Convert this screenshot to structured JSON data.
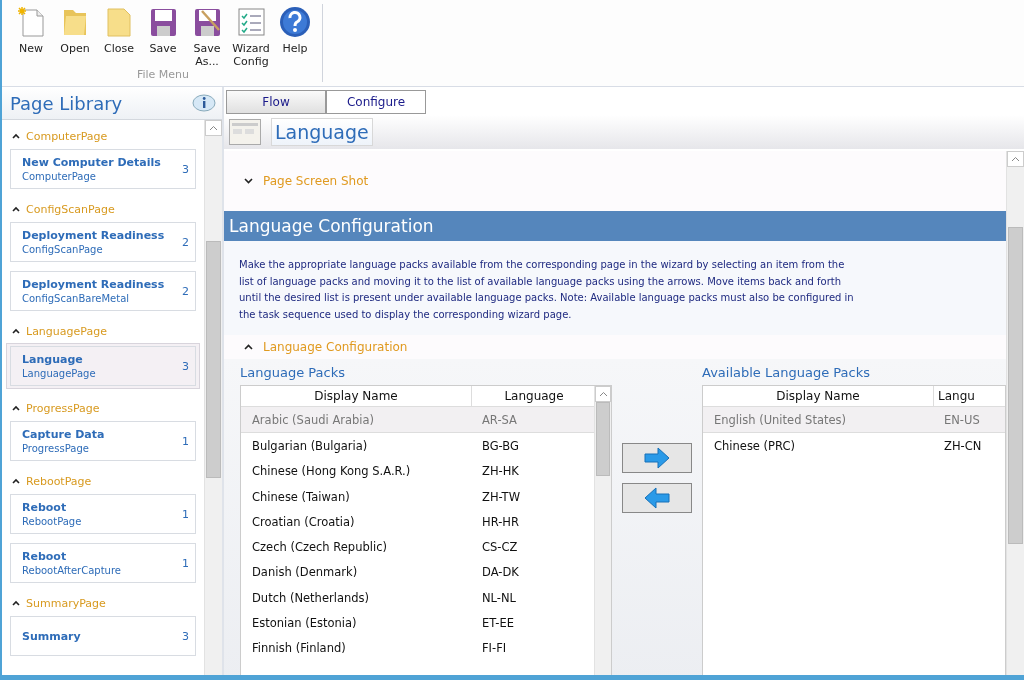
{
  "toolbar": {
    "group_label": "File Menu",
    "buttons": [
      {
        "label": "New",
        "kind": "new"
      },
      {
        "label": "Open",
        "kind": "open"
      },
      {
        "label": "Close",
        "kind": "close"
      },
      {
        "label": "Save",
        "kind": "save"
      },
      {
        "label": "Save As...",
        "kind": "saveas"
      },
      {
        "label": "Wizard Config",
        "kind": "wizard"
      },
      {
        "label": "Help",
        "kind": "help"
      }
    ]
  },
  "sidebar": {
    "title": "Page Library",
    "groups": [
      {
        "name": "ComputerPage",
        "expanded": true,
        "items": [
          {
            "title": "New Computer Details",
            "subtitle": "ComputerPage",
            "count": "3",
            "selected": false
          }
        ]
      },
      {
        "name": "ConfigScanPage",
        "expanded": true,
        "items": [
          {
            "title": "Deployment Readiness",
            "subtitle": "ConfigScanPage",
            "count": "2",
            "selected": false
          },
          {
            "title": "Deployment Readiness",
            "subtitle": "ConfigScanBareMetal",
            "count": "2",
            "selected": false
          }
        ]
      },
      {
        "name": "LanguagePage",
        "expanded": true,
        "items": [
          {
            "title": "Language",
            "subtitle": "LanguagePage",
            "count": "3",
            "selected": true
          }
        ]
      },
      {
        "name": "ProgressPage",
        "expanded": true,
        "items": [
          {
            "title": "Capture Data",
            "subtitle": "ProgressPage",
            "count": "1",
            "selected": false
          }
        ]
      },
      {
        "name": "RebootPage",
        "expanded": true,
        "items": [
          {
            "title": "Reboot",
            "subtitle": "RebootPage",
            "count": "1",
            "selected": false
          },
          {
            "title": "Reboot",
            "subtitle": "RebootAfterCapture",
            "count": "1",
            "selected": false
          }
        ]
      },
      {
        "name": "SummaryPage",
        "expanded": true,
        "items": [
          {
            "title": "Summary",
            "count": "3",
            "selected": false
          }
        ]
      }
    ]
  },
  "tabs": [
    {
      "label": "Flow",
      "selected": false
    },
    {
      "label": "Configure",
      "selected": true
    }
  ],
  "page_title": "Language",
  "screenshot_section": {
    "title": "Page Screen Shot",
    "expanded": false
  },
  "banner": "Language Configuration",
  "description": "Make the appropriate language packs available from the corresponding page in the wizard by selecting an item from the list of language packs and moving it to the list of available language packs using the arrows. Move items back and forth until the desired list is present under available language packs. Note: Available language packs must also be configured in the task sequence used to display the corresponding wizard page.",
  "config_section": {
    "title": "Language Configuration",
    "expanded": true
  },
  "language_packs": {
    "title": "Language Packs",
    "columns": [
      "Display Name",
      "Language"
    ],
    "rows": [
      {
        "name": "Arabic (Saudi Arabia)",
        "code": "AR-SA",
        "selected": true
      },
      {
        "name": "Bulgarian (Bulgaria)",
        "code": "BG-BG",
        "selected": false
      },
      {
        "name": "Chinese (Hong Kong S.A.R.)",
        "code": "ZH-HK",
        "selected": false
      },
      {
        "name": "Chinese (Taiwan)",
        "code": "ZH-TW",
        "selected": false
      },
      {
        "name": "Croatian (Croatia)",
        "code": "HR-HR",
        "selected": false
      },
      {
        "name": "Czech (Czech Republic)",
        "code": "CS-CZ",
        "selected": false
      },
      {
        "name": "Danish (Denmark)",
        "code": "DA-DK",
        "selected": false
      },
      {
        "name": "Dutch (Netherlands)",
        "code": "NL-NL",
        "selected": false
      },
      {
        "name": "Estonian (Estonia)",
        "code": "ET-EE",
        "selected": false
      },
      {
        "name": "Finnish (Finland)",
        "code": "FI-FI",
        "selected": false
      }
    ]
  },
  "available_packs": {
    "title": "Available Language Packs",
    "columns": [
      "Display Name",
      "Langu"
    ],
    "rows": [
      {
        "name": "English (United States)",
        "code": "EN-US",
        "selected": true
      },
      {
        "name": "Chinese (PRC)",
        "code": "ZH-CN",
        "selected": false
      }
    ]
  }
}
